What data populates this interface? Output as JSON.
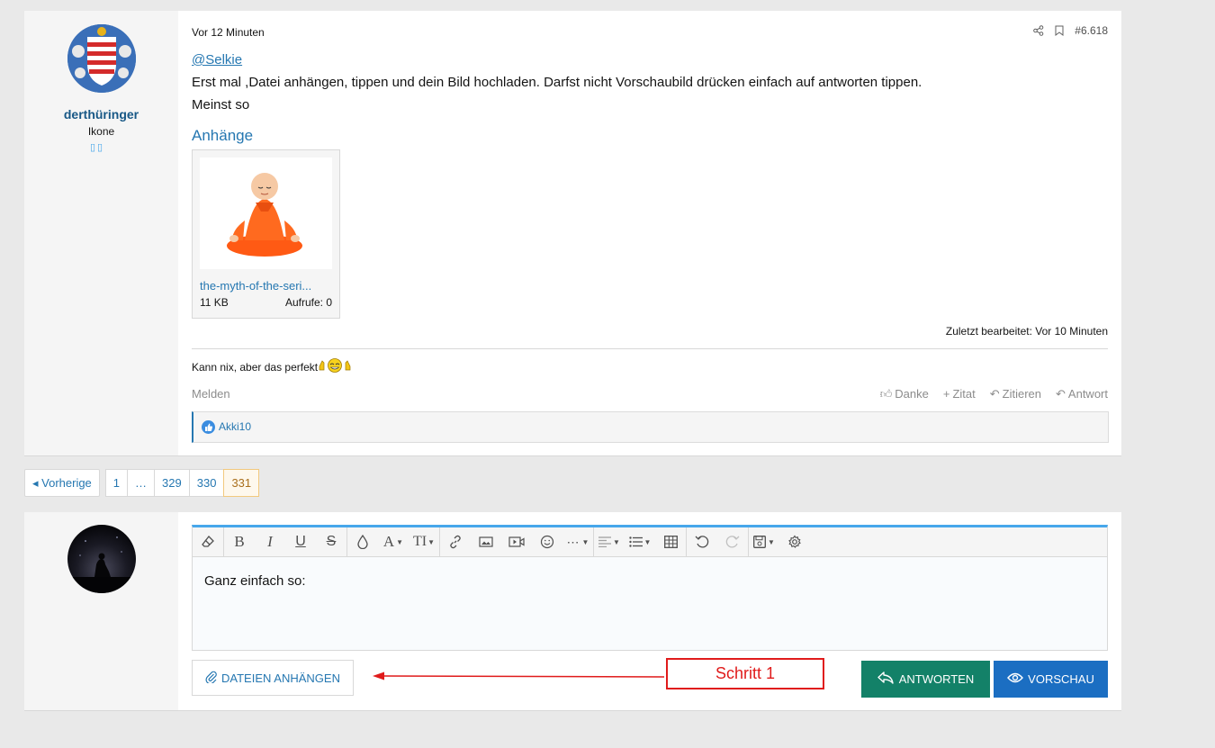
{
  "post": {
    "username": "derthüringer",
    "user_title": "Ikone",
    "user_badges": "▯▯",
    "time": "Vor 12 Minuten",
    "post_number": "#6.618",
    "mention": "@Selkie",
    "lines": [
      "Erst mal ,Datei anhängen, tippen und dein Bild hochladen. Darfst nicht Vorschaubild drücken einfach auf antworten tippen.",
      "Meinst so"
    ],
    "attachments_title": "Anhänge",
    "attachment": {
      "name": "the-myth-of-the-seri...",
      "size": "11 KB",
      "views": "Aufrufe: 0"
    },
    "edited": "Zuletzt bearbeitet: Vor 10 Minuten",
    "signature": "Kann nix, aber das perfekt",
    "report": "Melden",
    "actions": {
      "thanks": "Danke",
      "quote_plus": "Zitat",
      "quote": "Zitieren",
      "reply": "Antwort"
    },
    "reaction_user": "Akki10"
  },
  "pagination": {
    "prev": "Vorherige",
    "pages": [
      "1",
      "…",
      "329",
      "330",
      "331"
    ],
    "current": "331"
  },
  "reply": {
    "editor_text": "Ganz einfach so:",
    "attach_button": "DATEIEN ANHÄNGEN",
    "reply_button": "ANTWORTEN",
    "preview_button": "VORSCHAU"
  },
  "annotation": {
    "label": "Schritt 1",
    "color": "#e01b1b"
  },
  "colors": {
    "link": "#2577b1",
    "reply_button": "#138168",
    "preview_button": "#1b6ec2",
    "editor_accent": "#47a7eb"
  }
}
